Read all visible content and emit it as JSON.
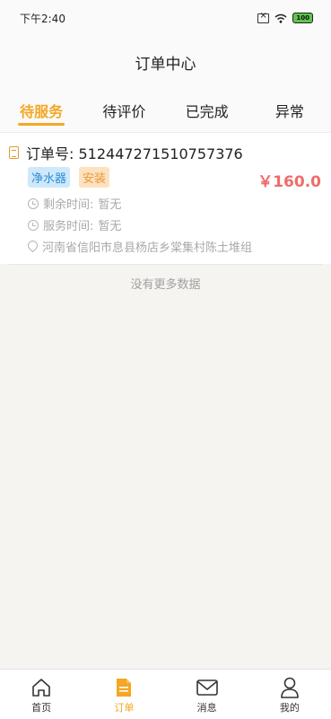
{
  "status_bar": {
    "time": "下午2:40",
    "battery": "100"
  },
  "header": {
    "title": "订单中心"
  },
  "tabs": [
    {
      "label": "待服务",
      "active": true
    },
    {
      "label": "待评价",
      "active": false
    },
    {
      "label": "已完成",
      "active": false
    },
    {
      "label": "异常",
      "active": false
    }
  ],
  "order": {
    "number_label": "订单号:",
    "number": "512447271510757376",
    "tags": [
      "净水器",
      "安装"
    ],
    "price": "￥160.0",
    "remaining_label": "剩余时间:",
    "remaining_value": "暂无",
    "service_label": "服务时间:",
    "service_value": "暂无",
    "address": "河南省信阳市息县杨店乡棠集村陈土堆组"
  },
  "list_footer": "没有更多数据",
  "bottom_nav": [
    {
      "label": "首页",
      "icon": "home-icon",
      "active": false
    },
    {
      "label": "订单",
      "icon": "order-icon",
      "active": true
    },
    {
      "label": "消息",
      "icon": "mail-icon",
      "active": false
    },
    {
      "label": "我的",
      "icon": "user-icon",
      "active": false
    }
  ],
  "colors": {
    "accent": "#f5a623",
    "price": "#f26a6a",
    "tag_blue": "#2b8fd6",
    "tag_orange": "#e9973a"
  }
}
